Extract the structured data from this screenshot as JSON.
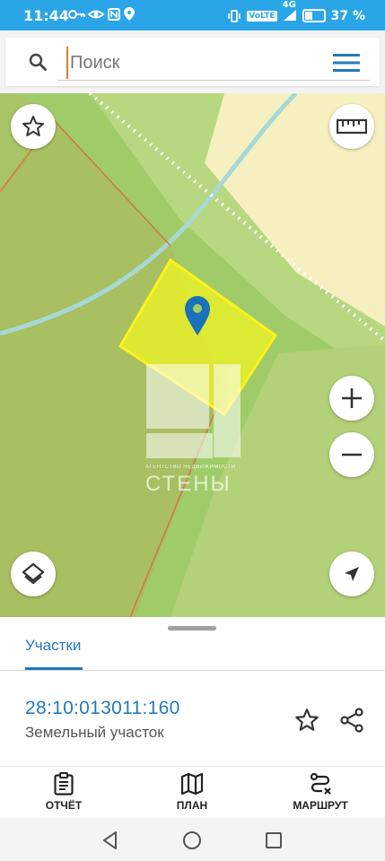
{
  "status": {
    "time": "11:44",
    "volte": "VoLTE",
    "network": "4G",
    "battery": "37 %"
  },
  "search": {
    "placeholder": "Поиск"
  },
  "map": {
    "watermark": {
      "subtitle": "АГЕНТСТВО НЕДВИЖИМОСТИ",
      "title": "СТЕНЫ"
    }
  },
  "sheet": {
    "tab": "Участки",
    "cadastral_number": "28:10:013011:160",
    "parcel_type": "Земельный участок"
  },
  "bottom_nav": {
    "report": "ОТЧЁТ",
    "plan": "ПЛАН",
    "route": "МАРШРУТ"
  },
  "colors": {
    "accent": "#2479bd",
    "status_bar": "#2aa6e8",
    "parcel_fill": "#e8ef2a",
    "marker": "#1a72b8"
  }
}
